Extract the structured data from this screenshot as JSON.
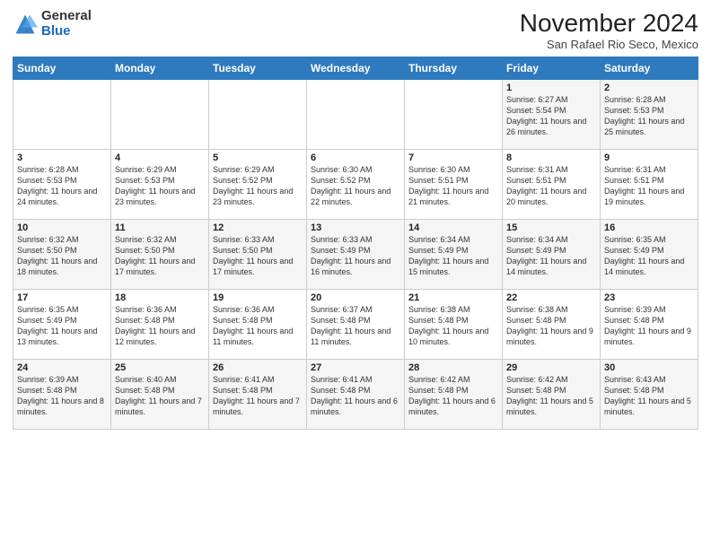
{
  "logo": {
    "general": "General",
    "blue": "Blue"
  },
  "title": "November 2024",
  "location": "San Rafael Rio Seco, Mexico",
  "days_header": [
    "Sunday",
    "Monday",
    "Tuesday",
    "Wednesday",
    "Thursday",
    "Friday",
    "Saturday"
  ],
  "weeks": [
    [
      {
        "day": "",
        "info": ""
      },
      {
        "day": "",
        "info": ""
      },
      {
        "day": "",
        "info": ""
      },
      {
        "day": "",
        "info": ""
      },
      {
        "day": "",
        "info": ""
      },
      {
        "day": "1",
        "info": "Sunrise: 6:27 AM\nSunset: 5:54 PM\nDaylight: 11 hours and 26 minutes."
      },
      {
        "day": "2",
        "info": "Sunrise: 6:28 AM\nSunset: 5:53 PM\nDaylight: 11 hours and 25 minutes."
      }
    ],
    [
      {
        "day": "3",
        "info": "Sunrise: 6:28 AM\nSunset: 5:53 PM\nDaylight: 11 hours and 24 minutes."
      },
      {
        "day": "4",
        "info": "Sunrise: 6:29 AM\nSunset: 5:53 PM\nDaylight: 11 hours and 23 minutes."
      },
      {
        "day": "5",
        "info": "Sunrise: 6:29 AM\nSunset: 5:52 PM\nDaylight: 11 hours and 23 minutes."
      },
      {
        "day": "6",
        "info": "Sunrise: 6:30 AM\nSunset: 5:52 PM\nDaylight: 11 hours and 22 minutes."
      },
      {
        "day": "7",
        "info": "Sunrise: 6:30 AM\nSunset: 5:51 PM\nDaylight: 11 hours and 21 minutes."
      },
      {
        "day": "8",
        "info": "Sunrise: 6:31 AM\nSunset: 5:51 PM\nDaylight: 11 hours and 20 minutes."
      },
      {
        "day": "9",
        "info": "Sunrise: 6:31 AM\nSunset: 5:51 PM\nDaylight: 11 hours and 19 minutes."
      }
    ],
    [
      {
        "day": "10",
        "info": "Sunrise: 6:32 AM\nSunset: 5:50 PM\nDaylight: 11 hours and 18 minutes."
      },
      {
        "day": "11",
        "info": "Sunrise: 6:32 AM\nSunset: 5:50 PM\nDaylight: 11 hours and 17 minutes."
      },
      {
        "day": "12",
        "info": "Sunrise: 6:33 AM\nSunset: 5:50 PM\nDaylight: 11 hours and 17 minutes."
      },
      {
        "day": "13",
        "info": "Sunrise: 6:33 AM\nSunset: 5:49 PM\nDaylight: 11 hours and 16 minutes."
      },
      {
        "day": "14",
        "info": "Sunrise: 6:34 AM\nSunset: 5:49 PM\nDaylight: 11 hours and 15 minutes."
      },
      {
        "day": "15",
        "info": "Sunrise: 6:34 AM\nSunset: 5:49 PM\nDaylight: 11 hours and 14 minutes."
      },
      {
        "day": "16",
        "info": "Sunrise: 6:35 AM\nSunset: 5:49 PM\nDaylight: 11 hours and 14 minutes."
      }
    ],
    [
      {
        "day": "17",
        "info": "Sunrise: 6:35 AM\nSunset: 5:49 PM\nDaylight: 11 hours and 13 minutes."
      },
      {
        "day": "18",
        "info": "Sunrise: 6:36 AM\nSunset: 5:48 PM\nDaylight: 11 hours and 12 minutes."
      },
      {
        "day": "19",
        "info": "Sunrise: 6:36 AM\nSunset: 5:48 PM\nDaylight: 11 hours and 11 minutes."
      },
      {
        "day": "20",
        "info": "Sunrise: 6:37 AM\nSunset: 5:48 PM\nDaylight: 11 hours and 11 minutes."
      },
      {
        "day": "21",
        "info": "Sunrise: 6:38 AM\nSunset: 5:48 PM\nDaylight: 11 hours and 10 minutes."
      },
      {
        "day": "22",
        "info": "Sunrise: 6:38 AM\nSunset: 5:48 PM\nDaylight: 11 hours and 9 minutes."
      },
      {
        "day": "23",
        "info": "Sunrise: 6:39 AM\nSunset: 5:48 PM\nDaylight: 11 hours and 9 minutes."
      }
    ],
    [
      {
        "day": "24",
        "info": "Sunrise: 6:39 AM\nSunset: 5:48 PM\nDaylight: 11 hours and 8 minutes."
      },
      {
        "day": "25",
        "info": "Sunrise: 6:40 AM\nSunset: 5:48 PM\nDaylight: 11 hours and 7 minutes."
      },
      {
        "day": "26",
        "info": "Sunrise: 6:41 AM\nSunset: 5:48 PM\nDaylight: 11 hours and 7 minutes."
      },
      {
        "day": "27",
        "info": "Sunrise: 6:41 AM\nSunset: 5:48 PM\nDaylight: 11 hours and 6 minutes."
      },
      {
        "day": "28",
        "info": "Sunrise: 6:42 AM\nSunset: 5:48 PM\nDaylight: 11 hours and 6 minutes."
      },
      {
        "day": "29",
        "info": "Sunrise: 6:42 AM\nSunset: 5:48 PM\nDaylight: 11 hours and 5 minutes."
      },
      {
        "day": "30",
        "info": "Sunrise: 6:43 AM\nSunset: 5:48 PM\nDaylight: 11 hours and 5 minutes."
      }
    ]
  ]
}
